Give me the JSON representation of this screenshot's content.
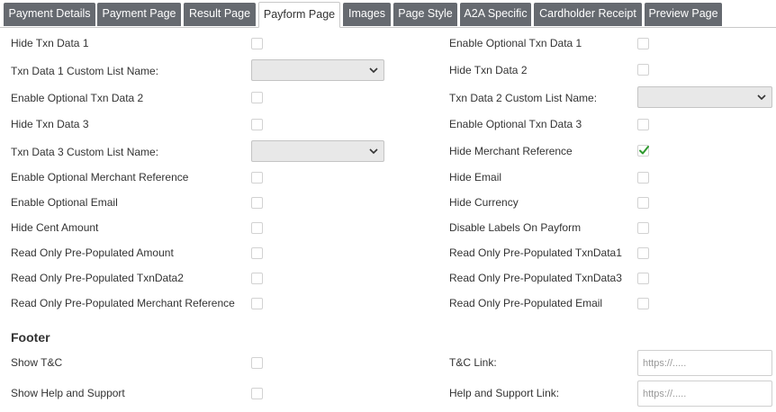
{
  "tabs": [
    {
      "label": "Payment Details",
      "active": false
    },
    {
      "label": "Payment Page",
      "active": false
    },
    {
      "label": "Result Page",
      "active": false
    },
    {
      "label": "Payform Page",
      "active": true
    },
    {
      "label": "Images",
      "active": false
    },
    {
      "label": "Page Style",
      "active": false
    },
    {
      "label": "A2A Specific",
      "active": false
    },
    {
      "label": "Cardholder Receipt",
      "active": false
    },
    {
      "label": "Preview Page",
      "active": false
    }
  ],
  "left_fields": [
    {
      "label": "Hide Txn Data 1",
      "type": "checkbox",
      "checked": false
    },
    {
      "label": "Txn Data 1 Custom List Name:",
      "type": "select",
      "value": ""
    },
    {
      "label": "Enable Optional Txn Data 2",
      "type": "checkbox",
      "checked": false
    },
    {
      "label": "Hide Txn Data 3",
      "type": "checkbox",
      "checked": false
    },
    {
      "label": "Txn Data 3 Custom List Name:",
      "type": "select",
      "value": ""
    },
    {
      "label": "Enable Optional Merchant Reference",
      "type": "checkbox",
      "checked": false
    },
    {
      "label": "Enable Optional Email",
      "type": "checkbox",
      "checked": false
    },
    {
      "label": "Hide Cent Amount",
      "type": "checkbox",
      "checked": false
    },
    {
      "label": "Read Only Pre-Populated Amount",
      "type": "checkbox",
      "checked": false
    },
    {
      "label": "Read Only Pre-Populated TxnData2",
      "type": "checkbox",
      "checked": false
    },
    {
      "label": "Read Only Pre-Populated Merchant Reference",
      "type": "checkbox",
      "checked": false
    }
  ],
  "right_fields": [
    {
      "label": "Enable Optional Txn Data 1",
      "type": "checkbox",
      "checked": false
    },
    {
      "label": "Hide Txn Data 2",
      "type": "checkbox",
      "checked": false
    },
    {
      "label": "Txn Data 2 Custom List Name:",
      "type": "select",
      "value": ""
    },
    {
      "label": "Enable Optional Txn Data 3",
      "type": "checkbox",
      "checked": false
    },
    {
      "label": "Hide Merchant Reference",
      "type": "checkbox",
      "checked": true
    },
    {
      "label": "Hide Email",
      "type": "checkbox",
      "checked": false
    },
    {
      "label": "Hide Currency",
      "type": "checkbox",
      "checked": false
    },
    {
      "label": "Disable Labels On Payform",
      "type": "checkbox",
      "checked": false
    },
    {
      "label": "Read Only Pre-Populated TxnData1",
      "type": "checkbox",
      "checked": false
    },
    {
      "label": "Read Only Pre-Populated TxnData3",
      "type": "checkbox",
      "checked": false
    },
    {
      "label": "Read Only Pre-Populated Email",
      "type": "checkbox",
      "checked": false
    }
  ],
  "footer": {
    "heading": "Footer",
    "show_tc": {
      "label": "Show T&C",
      "checked": false
    },
    "show_help": {
      "label": "Show Help and Support",
      "checked": false
    },
    "tc_link": {
      "label": "T&C Link:",
      "value": "",
      "placeholder": "https://....."
    },
    "help_link": {
      "label": "Help and Support Link:",
      "value": "",
      "placeholder": "https://....."
    }
  },
  "colors": {
    "tab_bg": "#666a70",
    "tab_text": "#ffffff",
    "check_mark": "#2e9a2e",
    "select_bg": "#e8e8e8"
  },
  "icons": {
    "select_arrow": "chevron-down-icon",
    "check": "checkmark-icon"
  }
}
